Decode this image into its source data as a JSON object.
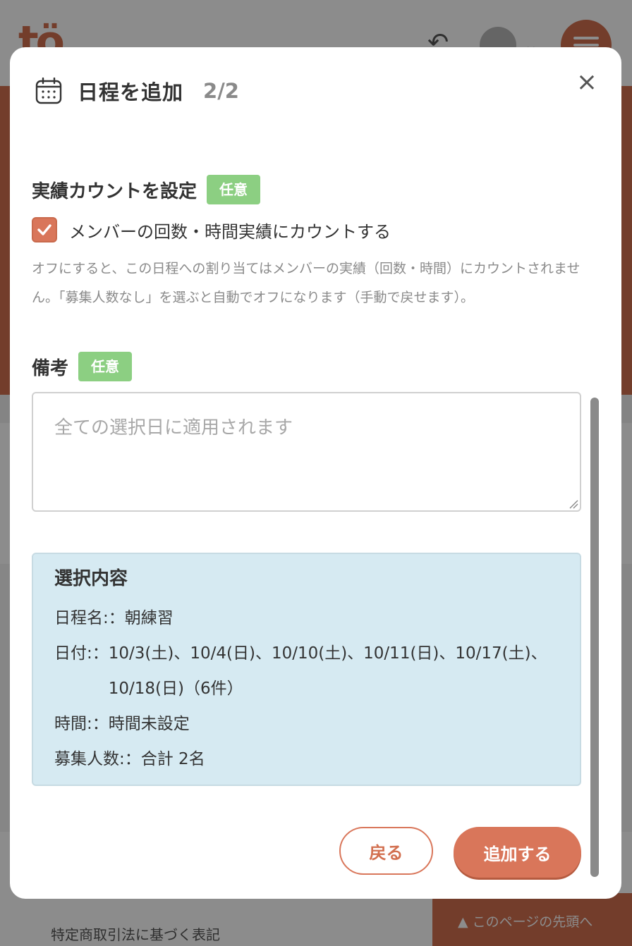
{
  "background": {
    "logo_text": "tö",
    "footer_link": "特定商取引法に基づく表記",
    "back_to_top": "▲ このページの先頭へ"
  },
  "modal": {
    "title": "日程を追加",
    "step": "2/2",
    "close": "×",
    "count_section": {
      "label": "実績カウントを設定",
      "badge": "任意",
      "checkbox_label": "メンバーの回数・時間実績にカウントする",
      "checked": true,
      "help": "オフにすると、この日程への割り当てはメンバーの実績（回数・時間）にカウントされません。「募集人数なし」を選ぶと自動でオフになります（手動で戻せます）。"
    },
    "notes_section": {
      "label": "備考",
      "badge": "任意",
      "placeholder": "全ての選択日に適用されます",
      "value": ""
    },
    "summary": {
      "title": "選択内容",
      "name_key": "日程名:：",
      "name_value": "朝練習",
      "dates_key": "日付:：",
      "dates_value": "10/3(土)、10/4(日)、10/10(土)、10/11(日)、10/17(土)、10/18(日)（6件）",
      "time_key": "時間:：",
      "time_value": "時間未設定",
      "count_key": "募集人数:：",
      "count_value": "合計 2名"
    },
    "buttons": {
      "back": "戻る",
      "add": "追加する"
    }
  },
  "colors": {
    "accent": "#d9765a",
    "badge": "#8ccf82",
    "summary_bg": "#d6eaf2"
  }
}
